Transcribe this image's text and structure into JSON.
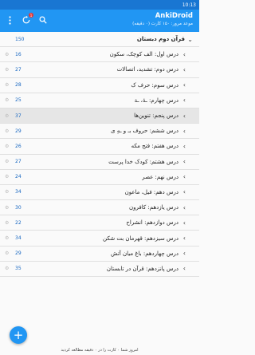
{
  "status_bar": {
    "time": "10:13"
  },
  "app_bar": {
    "title": "AnkiDroid",
    "subtitle": "موعد مرور: ۱۵۰ کارت (۰ دقیقه)",
    "sync_badge": "1"
  },
  "parent_deck": {
    "name": "قرآن دوم دبستان",
    "count": "150"
  },
  "decks": [
    {
      "name": "درس اول: الف کوچک، سکون",
      "count": "16"
    },
    {
      "name": "درس دوم: تشدید، اتصالات",
      "count": "27"
    },
    {
      "name": "درس سوم: حرف ک",
      "count": "28"
    },
    {
      "name": "درس چهارم: ـهٔ، ـة",
      "count": "25"
    },
    {
      "name": "درس پنجم: تنوین‌ها",
      "count": "37"
    },
    {
      "name": "درس ششم: حروف بـ و ـهِ ی",
      "count": "29"
    },
    {
      "name": "درس هفتم: فتح مکه",
      "count": "26"
    },
    {
      "name": "درس هشتم: کودک خدا پرست",
      "count": "27"
    },
    {
      "name": "درس نهم: عصر",
      "count": "24"
    },
    {
      "name": "درس دهم: فیل، ماعون",
      "count": "34"
    },
    {
      "name": "درس یازدهم: کافرون",
      "count": "30"
    },
    {
      "name": "درس دوازدهم: انشراح",
      "count": "22"
    },
    {
      "name": "درس سیزدهم: قهرمان بت شکن",
      "count": "34"
    },
    {
      "name": "درس چهاردهم: باغ میان آتش",
      "count": "29"
    },
    {
      "name": "درس پانزدهم: قرآن در تابستان",
      "count": "35"
    }
  ],
  "footer": {
    "text": "امروز شما ۰ کارت را در ۰ دقیقه مطالعه کردید"
  },
  "fab": {
    "symbol": "+"
  },
  "colors": {
    "primary": "#2196f3",
    "status_bar": "#1976d2",
    "count": "#1565c0"
  }
}
